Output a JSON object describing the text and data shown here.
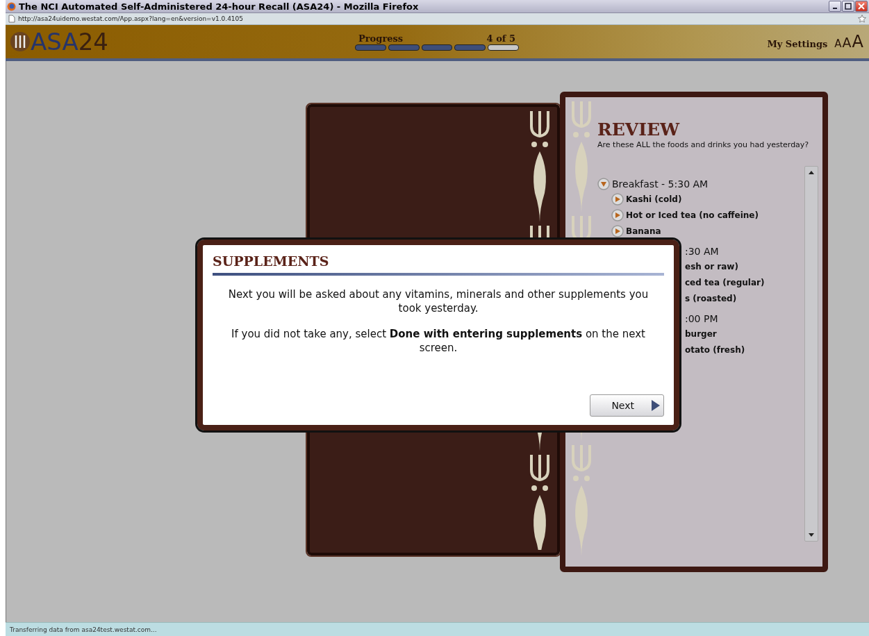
{
  "window": {
    "title": "The NCI Automated Self-Administered 24-hour Recall (ASA24) - Mozilla Firefox",
    "address": "http://asa24uidemo.westat.com/App.aspx?lang=en&version=v1.0.4105"
  },
  "header": {
    "logo": "ASA",
    "logo_number": "24",
    "progress": {
      "label": "Progress",
      "count": "4 of 5",
      "segments": [
        {
          "done": true
        },
        {
          "done": true
        },
        {
          "done": true
        },
        {
          "done": true
        },
        {
          "done": false
        }
      ]
    },
    "settings": "My Settings",
    "text_sizes": [
      "A",
      "A",
      "A"
    ]
  },
  "review": {
    "title": "REVIEW",
    "subtitle": "Are these ALL the foods and drinks you had yesterday?",
    "meals": [
      {
        "label": "Breakfast - 5:30 AM",
        "kind": "full",
        "items": [
          {
            "label": "Kashi (cold)",
            "kind": "full"
          },
          {
            "label": "Hot or Iced tea (no caffeine)",
            "kind": "full"
          },
          {
            "label": "Banana",
            "kind": "full"
          }
        ]
      },
      {
        "label": ":30 AM",
        "kind": "partial",
        "items": [
          {
            "label": "esh or raw)",
            "kind": "partial"
          },
          {
            "label": "ced tea (regular)",
            "kind": "partial"
          },
          {
            "label": "s (roasted)",
            "kind": "partial"
          }
        ]
      },
      {
        "label": ":00 PM",
        "kind": "partial",
        "items": [
          {
            "label": "burger",
            "kind": "partial"
          },
          {
            "label": "otato (fresh)",
            "kind": "partial"
          }
        ]
      }
    ]
  },
  "dialog": {
    "title": "SUPPLEMENTS",
    "paragraphs": [
      "Next you will be asked about any vitamins, minerals and other supplements you took yesterday.",
      "If you did not take any, select **Done with entering supplements** on the next screen."
    ],
    "button": "Next"
  },
  "status_bar": "Transferring data from asa24test.westat.com..."
}
